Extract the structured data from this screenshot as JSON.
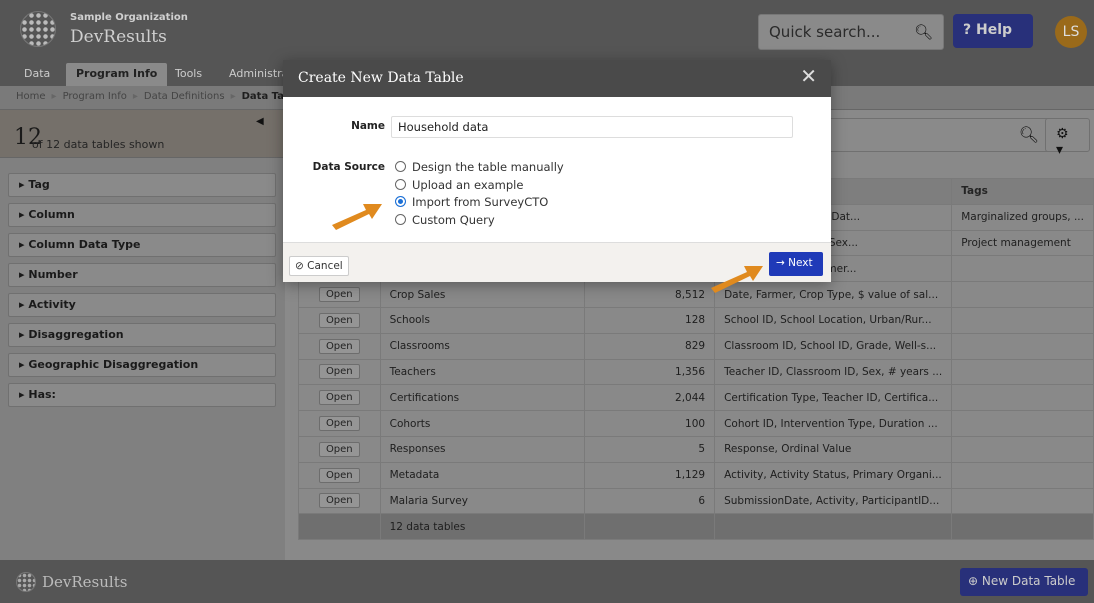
{
  "header": {
    "org_name": "Sample Organization",
    "app_name": "DevResults",
    "search_placeholder": "Quick search...",
    "help_label": "Help",
    "avatar_initials": "LS"
  },
  "nav": {
    "tabs": [
      "Data",
      "Program Info",
      "Tools",
      "Administra"
    ],
    "active": "Program Info"
  },
  "breadcrumb": [
    "Home",
    "Program Info",
    "Data Definitions",
    "Data Ta"
  ],
  "sidebar": {
    "count": "12",
    "count_text": "of 12 data tables shown",
    "facets": [
      "Tag",
      "Column",
      "Column Data Type",
      "Number",
      "Activity",
      "Disaggregation",
      "Geographic Disaggregation",
      "Has:"
    ]
  },
  "table": {
    "headers": [
      "",
      "",
      "",
      "",
      "Tags"
    ],
    "rows": [
      {
        "open": "",
        "name": "",
        "count": "",
        "columns": "ame, Contract Start Dat...",
        "tags": "Marginalized groups, ..."
      },
      {
        "open": "",
        "name": "",
        "count": "",
        "columns": "ocation, Trainee ID, Sex...",
        "tags": "Project management"
      },
      {
        "open": "",
        "name": "",
        "count": "",
        "columns": "ogram, Activity, Farmer...",
        "tags": ""
      },
      {
        "open": "Open",
        "name": "Crop Sales",
        "count": "8,512",
        "columns": "Date, Farmer, Crop Type, $ value of sal...",
        "tags": ""
      },
      {
        "open": "Open",
        "name": "Schools",
        "count": "128",
        "columns": "School ID, School Location, Urban/Rur...",
        "tags": ""
      },
      {
        "open": "Open",
        "name": "Classrooms",
        "count": "829",
        "columns": "Classroom ID, School ID, Grade, Well-s...",
        "tags": ""
      },
      {
        "open": "Open",
        "name": "Teachers",
        "count": "1,356",
        "columns": "Teacher ID, Classroom ID, Sex, # years ...",
        "tags": ""
      },
      {
        "open": "Open",
        "name": "Certifications",
        "count": "2,044",
        "columns": "Certification Type, Teacher ID, Certifica...",
        "tags": ""
      },
      {
        "open": "Open",
        "name": "Cohorts",
        "count": "100",
        "columns": "Cohort ID, Intervention Type, Duration ...",
        "tags": ""
      },
      {
        "open": "Open",
        "name": "Responses",
        "count": "5",
        "columns": "Response, Ordinal Value",
        "tags": ""
      },
      {
        "open": "Open",
        "name": "Metadata",
        "count": "1,129",
        "columns": "Activity, Activity Status, Primary Organi...",
        "tags": ""
      },
      {
        "open": "Open",
        "name": "Malaria Survey",
        "count": "6",
        "columns": "SubmissionDate, Activity, ParticipantID...",
        "tags": ""
      }
    ],
    "footer": "12 data tables"
  },
  "footer": {
    "app_name": "DevResults",
    "new_table_label": "New Data Table"
  },
  "modal": {
    "title": "Create New Data Table",
    "name_label": "Name",
    "name_value": "Household data",
    "source_label": "Data Source",
    "options": [
      "Design the table manually",
      "Upload an example",
      "Import from SurveyCTO",
      "Custom Query"
    ],
    "selected": "Import from SurveyCTO",
    "cancel_label": "Cancel",
    "next_label": "Next"
  },
  "colors": {
    "accent": "#1f3ab8",
    "arrow": "#e08a1e",
    "modal_header": "#4a4a4a"
  }
}
